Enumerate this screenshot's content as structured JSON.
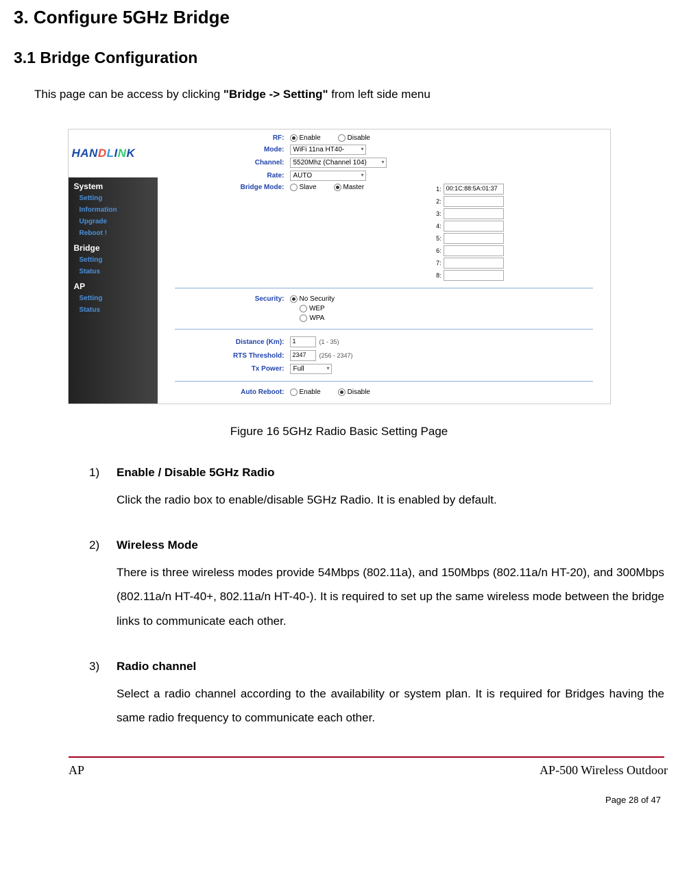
{
  "headings": {
    "h1": "3.    Configure 5GHz Bridge",
    "h2": "3.1    Bridge Configuration"
  },
  "intro": {
    "prefix": "This page can be access by clicking ",
    "bold": "\"Bridge -> Setting\"",
    "suffix": " from left side menu"
  },
  "screenshot": {
    "logo_parts": [
      "HAN",
      "D",
      "L",
      "I",
      "N",
      "K"
    ],
    "nav": {
      "system": {
        "label": "System",
        "items": [
          "Setting",
          "Information",
          "Upgrade",
          "Reboot !"
        ]
      },
      "bridge": {
        "label": "Bridge",
        "items": [
          "Setting",
          "Status"
        ]
      },
      "ap": {
        "label": "AP",
        "items": [
          "Setting",
          "Status"
        ]
      }
    },
    "fields": {
      "rf": {
        "label": "RF:",
        "enable": "Enable",
        "disable": "Disable",
        "selected": "enable"
      },
      "mode": {
        "label": "Mode:",
        "value": "WiFi 11na HT40-"
      },
      "channel": {
        "label": "Channel:",
        "value": "5520Mhz (Channel 104)"
      },
      "rate": {
        "label": "Rate:",
        "value": "AUTO"
      },
      "bridge_mode": {
        "label": "Bridge Mode:",
        "slave": "Slave",
        "master": "Master",
        "selected": "master"
      },
      "mac_entries": [
        "00:1C:88:5A:01:37",
        "",
        "",
        "",
        "",
        "",
        "",
        ""
      ],
      "security": {
        "label": "Security:",
        "no_security": "No Security",
        "wep": "WEP",
        "wpa": "WPA",
        "selected": "no_security"
      },
      "distance": {
        "label": "Distance (Km):",
        "value": "1",
        "hint": "(1 - 35)"
      },
      "rts": {
        "label": "RTS Threshold:",
        "value": "2347",
        "hint": "(256 - 2347)"
      },
      "txpower": {
        "label": "Tx Power:",
        "value": "Full"
      },
      "autoreboot": {
        "label": "Auto Reboot:",
        "enable": "Enable",
        "disable": "Disable",
        "selected": "disable"
      }
    }
  },
  "caption": "Figure 16    5GHz Radio Basic Setting Page",
  "items": [
    {
      "num": "1)",
      "title": "Enable / Disable 5GHz Radio",
      "body": "Click the radio box to enable/disable 5GHz Radio. It is enabled by default.",
      "justify": false
    },
    {
      "num": "2)",
      "title": "Wireless Mode",
      "body": "There is three wireless modes provide 54Mbps (802.11a), and 150Mbps (802.11a/n HT-20), and 300Mbps (802.11a/n HT-40+, 802.11a/n HT-40-). It is required to set up the same wireless mode between the bridge links to communicate each other.",
      "justify": true
    },
    {
      "num": "3)",
      "title": "Radio channel",
      "body": "Select a radio channel according to the availability or system plan. It is required for Bridges having the same radio frequency to communicate each other.",
      "justify": true
    }
  ],
  "footer": {
    "left": "AP",
    "right": "AP-500    Wireless  Outdoor",
    "page": "Page 28 of 47"
  }
}
